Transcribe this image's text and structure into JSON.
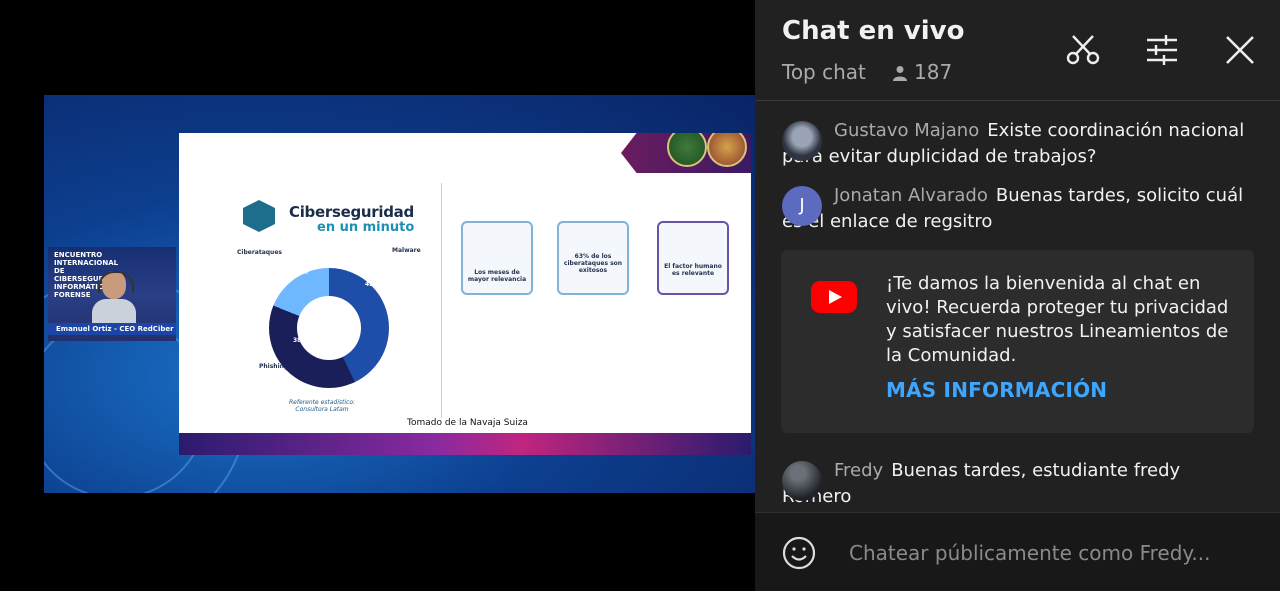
{
  "video": {
    "slide_title_line1": "Ciberseguridad",
    "slide_title_line2": "en un minuto",
    "slide_caption": "Tomado de la Navaja Suiza",
    "slide_source_line1": "Referente estadístico:",
    "slide_source_line2": "Consultora Latam",
    "slide_percent_a": "42.9%",
    "slide_percent_b": "38.2%",
    "slide_percent_c": "18.6%",
    "slide_label_cyberattacks": "Ciberataques",
    "slide_label_malware": "Malware",
    "slide_label_phishing": "Phishing",
    "slide_card1": "Los meses de mayor relevancia",
    "slide_card2": "63% de los ciberataques son exitosos",
    "slide_card3": "El factor humano es relevante",
    "webcam_title": "ENCUENTRO INTERNACIONAL DE CIBERSEGURIDAD INFORMÁTICA FORENSE",
    "webcam_label": "Emanuel Ortiz - CEO RedCiber ..."
  },
  "chat": {
    "title": "Chat en vivo",
    "mode": "Top chat",
    "viewer_count": "187",
    "messages": [
      {
        "author": "Gustavo Majano",
        "text": "Existe coordinación nacional para evitar duplicidad de trabajos?",
        "avatar_letter": "",
        "avatar_color": "#2d3340"
      },
      {
        "author": "Jonatan Alvarado",
        "text": "Buenas tardes, solicito cuál es el enlace de regsitro",
        "avatar_letter": "J",
        "avatar_color": "#5c6bc0"
      },
      {
        "author": "Fredy",
        "text": "Buenas tardes, estudiante fredy Romero",
        "avatar_letter": "",
        "avatar_color": "#3b3b3b"
      }
    ],
    "welcome": {
      "text": "¡Te damos la bienvenida al chat en vivo! Recuerda proteger tu privacidad y satisfacer nuestros Lineamientos de la Comunidad.",
      "link": "MÁS INFORMACIÓN"
    },
    "input_placeholder": "Chatear públicamente como Fredy..."
  },
  "colors": {
    "chat_bg": "#212121",
    "link": "#3ea6ff",
    "youtube_red": "#ff0000"
  },
  "icons": [
    "scissors-icon",
    "sliders-icon",
    "close-icon",
    "person-icon",
    "youtube-icon",
    "emoji-icon"
  ]
}
